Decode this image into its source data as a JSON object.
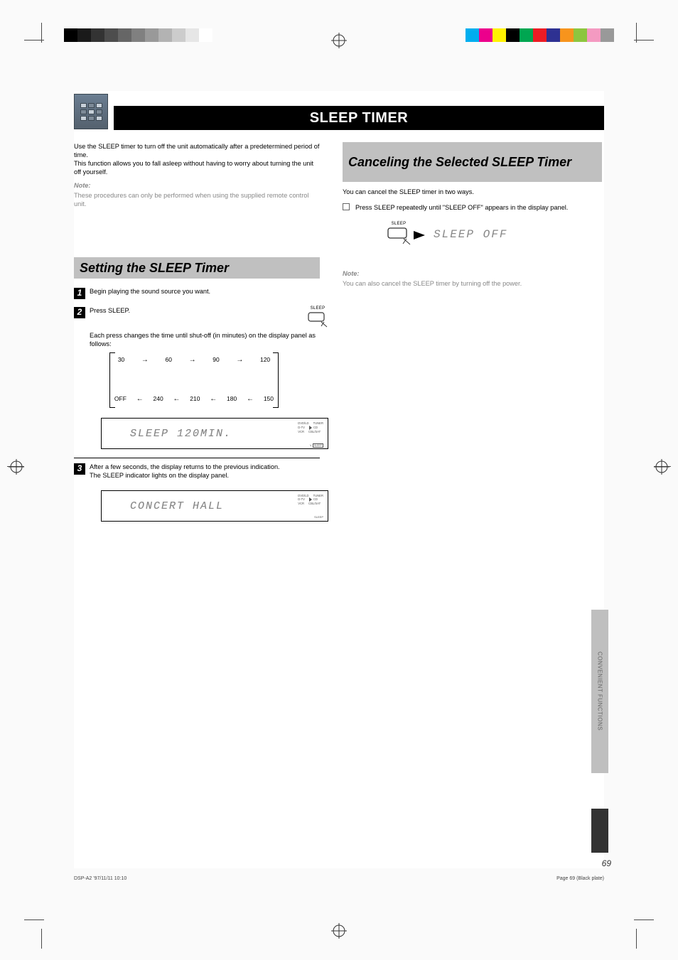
{
  "header": {
    "title": "SLEEP TIMER"
  },
  "intro": {
    "p1": "Use the SLEEP timer to turn off the unit automatically after a predetermined period of time.",
    "p2": "This function allows you to fall asleep without having to worry about turning the unit off yourself."
  },
  "note": {
    "heading": "Note:",
    "body": "These procedures can only be performed when using the supplied remote control unit."
  },
  "left": {
    "subhead": "Setting the SLEEP Timer",
    "step1": "Begin playing the sound source you want.",
    "step2a": "Press SLEEP.",
    "step2b": "Each press changes the time until shut-off (in minutes) on the display panel as follows:",
    "ladder_top": [
      "30",
      "60",
      "90",
      "120"
    ],
    "ladder_bot": [
      "OFF",
      "240",
      "210",
      "180",
      "150"
    ],
    "panel1_seg": "SLEEP 120MIN.",
    "panel_src": {
      "a1": "DVD/LD",
      "a2": "D-TV",
      "a3": "VCR",
      "b1": "TUNER",
      "b2": "CD",
      "b3": "CBL/SAT"
    },
    "panel1_flag": "SLEEP",
    "step3a": "After a few seconds, the display returns to the previous indication.",
    "step3b": "The SLEEP indicator lights on the display panel.",
    "panel2_seg": "CONCERT HALL",
    "panel2_flag": "SLEEP"
  },
  "right": {
    "subhead": "Canceling the Selected SLEEP Timer",
    "p1": "You can cancel the SLEEP timer in two ways.",
    "step_text": "Press SLEEP repeatedly until \"SLEEP OFF\" appears in the display panel.",
    "sleep_label": "SLEEP",
    "seg": "SLEEP OFF",
    "note_heading": "Note:",
    "note_body": "You can also cancel the SLEEP timer by turning off the power."
  },
  "side_tab": "CONVENIENT FUNCTIONS",
  "footer": {
    "left": "DSP-A2 '97/11/11 10:10",
    "right": "Page 69 (Black plate)",
    "page": "69"
  },
  "colors_left": [
    "#000000",
    "#1a1a1a",
    "#333333",
    "#4d4d4d",
    "#666666",
    "#808080",
    "#999999",
    "#b3b3b3",
    "#cccccc",
    "#e6e6e6",
    "#ffffff"
  ],
  "colors_right": [
    "#00aeef",
    "#ec008c",
    "#fff200",
    "#000000",
    "#00a651",
    "#ed1c24",
    "#2e3192",
    "#f7941d",
    "#8dc63f",
    "#f49ac1",
    "#999999"
  ]
}
